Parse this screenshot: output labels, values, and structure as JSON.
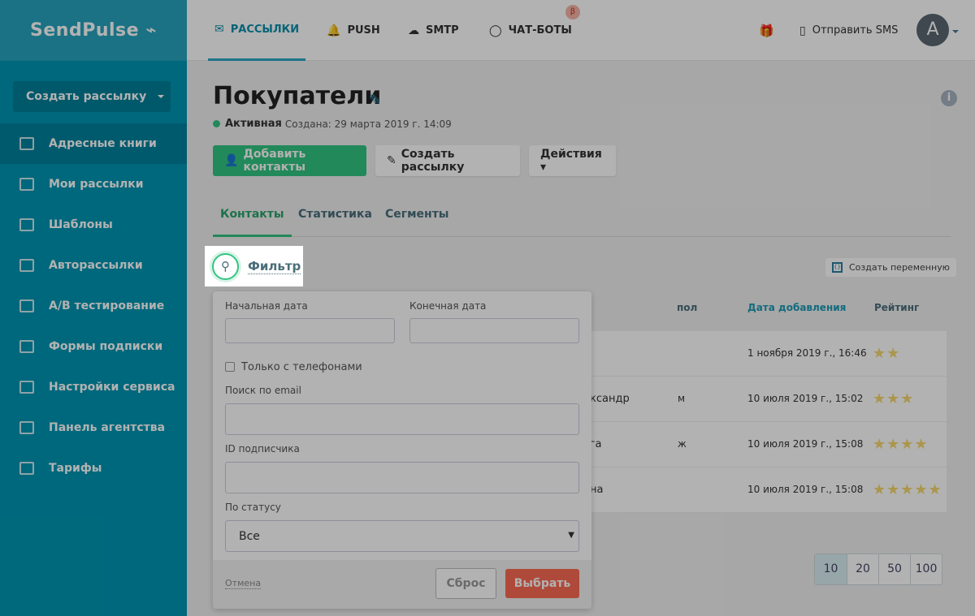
{
  "logo": "SendPulse",
  "sidebar": {
    "create_button": "Создать рассылку",
    "items": [
      {
        "label": "Адресные книги",
        "icon": "address-book-icon",
        "active": true
      },
      {
        "label": "Мои рассылки",
        "icon": "upload-icon"
      },
      {
        "label": "Шаблоны",
        "icon": "templates-icon"
      },
      {
        "label": "Авторассылки",
        "icon": "automation-icon"
      },
      {
        "label": "A/B тестирование",
        "icon": "ab-test-icon"
      },
      {
        "label": "Формы подписки",
        "icon": "form-icon"
      },
      {
        "label": "Настройки сервиса",
        "icon": "settings-icon"
      },
      {
        "label": "Панель агентства",
        "icon": "briefcase-icon"
      },
      {
        "label": "Тарифы",
        "icon": "wallet-icon"
      }
    ]
  },
  "header": {
    "nav": [
      {
        "label": "РАССЫЛКИ",
        "icon": "envelope-icon"
      },
      {
        "label": "PUSH",
        "icon": "bell-icon"
      },
      {
        "label": "SMTP",
        "icon": "cloud-upload-icon"
      },
      {
        "label": "ЧАТ-БОТЫ",
        "icon": "chat-icon"
      }
    ],
    "beta": "β",
    "sms": "Отправить SMS",
    "avatar": "A"
  },
  "page": {
    "title": "Покупатели",
    "status": "Активная",
    "created": "Создана: 29 марта 2019 г. 14:09",
    "add_contacts": "Добавить контакты",
    "create_campaign": "Создать рассылку",
    "actions": "Действия ▾",
    "tabs": [
      "Контакты",
      "Статистика",
      "Сегменты"
    ],
    "filter": "Фильтр",
    "create_variable": "Создать переменную"
  },
  "table": {
    "headers": [
      "пол",
      "Дата добавления",
      "Рейтинг"
    ],
    "rows": [
      {
        "name": "",
        "gender": "",
        "date": "1 ноября 2019 г., 16:46",
        "rating": 2
      },
      {
        "name": "ександр",
        "gender": "м",
        "date": "10 июля 2019 г., 15:02",
        "rating": 3
      },
      {
        "name": "ьга",
        "gender": "ж",
        "date": "10 июля 2019 г., 15:08",
        "rating": 4
      },
      {
        "name": "ена",
        "gender": "",
        "date": "10 июля 2019 г., 15:08",
        "rating": 5
      }
    ]
  },
  "pager": [
    "10",
    "20",
    "50",
    "100"
  ],
  "filter_popup": {
    "start_date": "Начальная дата",
    "end_date": "Конечная дата",
    "phones_only": "Только с телефонами",
    "email_search": "Поиск по email",
    "subscriber_id": "ID подписчика",
    "by_status": "По статусу",
    "status_value": "Все",
    "cancel": "Отмена",
    "reset": "Сброс",
    "choose": "Выбрать"
  },
  "colors": {
    "sidebar": "#0096b2",
    "green": "#32c482",
    "red": "#fb6a53",
    "star": "#f5d76e"
  }
}
